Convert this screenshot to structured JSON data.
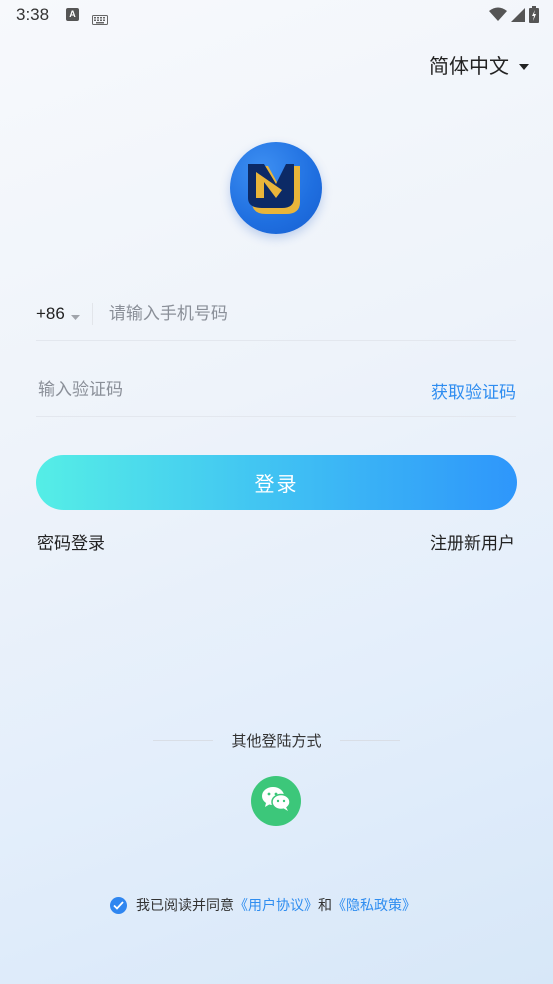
{
  "status_bar": {
    "time": "3:38",
    "icons": [
      "a-notification-icon",
      "keyboard-icon",
      "wifi-icon",
      "signal-icon",
      "battery-icon"
    ]
  },
  "language": {
    "label": "简体中文",
    "icon": "triangle-down-icon"
  },
  "logo": {
    "icon": "app-logo"
  },
  "phone": {
    "country_code": "+86",
    "placeholder": "请输入手机号码",
    "value": ""
  },
  "code": {
    "placeholder": "输入验证码",
    "value": "",
    "get_code_label": "获取验证码"
  },
  "login_button": {
    "label": "登录"
  },
  "links": {
    "password_login": "密码登录",
    "register": "注册新用户"
  },
  "other_login": {
    "label": "其他登陆方式",
    "wechat_icon": "wechat-icon"
  },
  "agreement": {
    "prefix": "我已阅读并同意",
    "user_agreement": "《用户协议》",
    "and": "和",
    "privacy_policy": "《隐私政策》",
    "checked": true
  },
  "colors": {
    "accent": "#2f8df0",
    "button_start": "#55eee6",
    "button_end": "#2e96fb",
    "wechat": "#3cc77a"
  }
}
